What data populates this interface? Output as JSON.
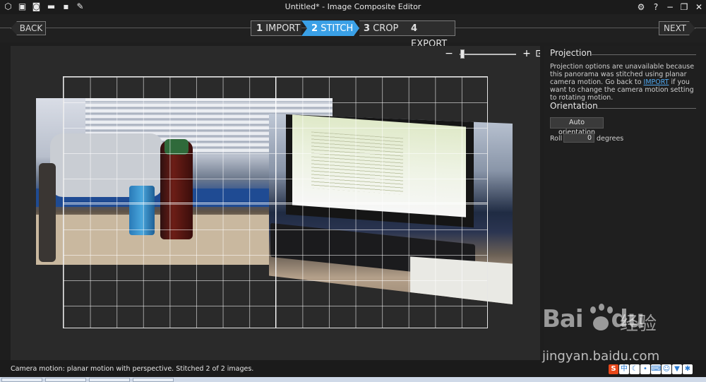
{
  "app": {
    "window_title": "Untitled* - Image Composite Editor"
  },
  "quick_access": {
    "icons": [
      "new-project-icon",
      "new-from-camera-icon",
      "open-folder-icon",
      "save-icon",
      "edit-icon"
    ]
  },
  "window_controls": {
    "icons": [
      "settings-icon",
      "help-icon",
      "minimize-icon",
      "restore-icon",
      "close-icon"
    ],
    "settings_glyph": "⚙",
    "help_glyph": "?",
    "minimize_glyph": "−",
    "restore_glyph": "❐",
    "close_glyph": "✕"
  },
  "steps": {
    "back_label": "BACK",
    "next_label": "NEXT",
    "items": [
      {
        "num": "1",
        "label": "IMPORT",
        "active": false
      },
      {
        "num": "2",
        "label": "STITCH",
        "active": true
      },
      {
        "num": "3",
        "label": "CROP",
        "active": false
      },
      {
        "num": "4",
        "label": "EXPORT",
        "active": false
      }
    ],
    "active_color": "#3aa0e6"
  },
  "zoom": {
    "minus_glyph": "−",
    "plus_glyph": "+",
    "fit_glyph": "⊡",
    "level": 0.05
  },
  "panel": {
    "projection": {
      "title": "Projection",
      "text_before": "Projection options are unavailable because this panorama was stitched using planar camera motion. Go back to ",
      "link_label": "IMPORT",
      "text_after": " if you want to change the camera motion setting to rotating motion."
    },
    "orientation": {
      "title": "Orientation",
      "auto_button": "Auto orientation",
      "roll_label": "Roll",
      "roll_value": "0",
      "roll_unit": "degrees"
    }
  },
  "status": {
    "text": "Camera motion: planar motion with perspective. Stitched 2 of 2 images."
  },
  "tray": {
    "ime_label": "S",
    "ime_lang": "中",
    "icons": [
      "ime-sogou-icon",
      "chinese-input-icon",
      "moon-icon",
      "punctuation-icon",
      "keyboard-icon",
      "user-icon",
      "shirt-icon",
      "settings-tray-icon"
    ]
  },
  "watermark": {
    "logo": "Bai",
    "logo_suffix": "du",
    "chinese": "经验",
    "url": "jingyan.baidu.com"
  }
}
